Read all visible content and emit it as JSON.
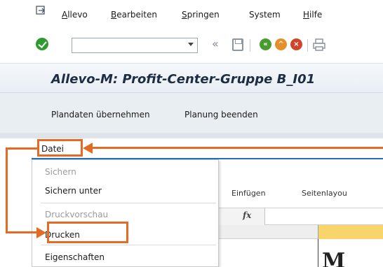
{
  "menubar": {
    "items": [
      {
        "label": "Allevo",
        "ul": "A",
        "rest": "llevo"
      },
      {
        "label": "Bearbeiten",
        "ul": "B",
        "rest": "earbeiten"
      },
      {
        "label": "Springen",
        "ul": "S",
        "rest": "pringen"
      },
      {
        "label": "System",
        "ul": "",
        "rest": "System"
      },
      {
        "label": "Hilfe",
        "ul": "H",
        "rest": "ilfe"
      }
    ]
  },
  "toolbar": {
    "command_field_value": "",
    "nav_back_glyph": "«"
  },
  "title": "Allevo-M: Profit-Center-Gruppe B_I01",
  "app_toolbar": {
    "btn_1": "Plandaten übernehmen",
    "btn_2": "Planung beenden"
  },
  "excel": {
    "file_menu_label": "Datei",
    "ribbon_tab_1": "Einfügen",
    "ribbon_tab_2": "Seitenlayou",
    "fx_label": "fx",
    "big_cell_glyph": "M"
  },
  "file_menu": {
    "items": [
      {
        "label": "Sichern",
        "state": "disabled"
      },
      {
        "label": "Sichern unter",
        "state": "enabled"
      },
      {
        "label": "Druckvorschau",
        "state": "disabled"
      },
      {
        "label": "Drucken",
        "state": "enabled"
      },
      {
        "label": "Eigenschaften",
        "state": "enabled"
      }
    ]
  },
  "colors": {
    "annotation": "#e36b24",
    "ok_green": "#2f9a2f",
    "excel_accent": "#2a6bb8",
    "column_highlight": "#f7d56b"
  },
  "icons": [
    "exit-icon",
    "ok-check-icon",
    "dropdown-arrow-icon",
    "back-icon",
    "save-icon",
    "nav-back-green-icon",
    "nav-up-orange-icon",
    "cancel-red-icon",
    "print-icon"
  ]
}
